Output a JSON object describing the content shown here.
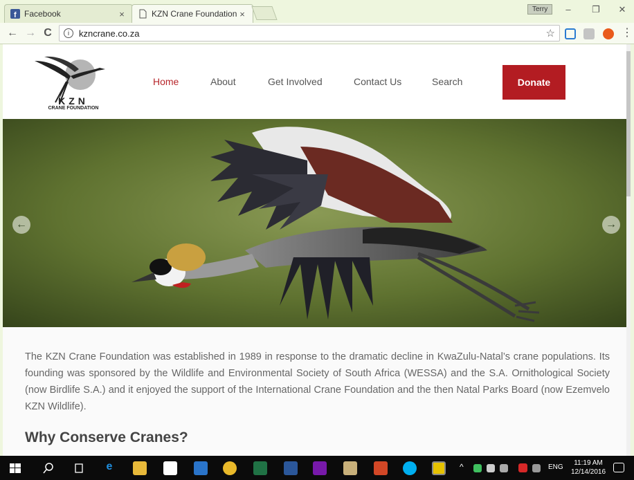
{
  "browser": {
    "tabs": [
      {
        "label": "Facebook",
        "close": "×"
      },
      {
        "label": "KZN Crane Foundation –",
        "close": "×"
      }
    ],
    "user": "Terry",
    "window_controls": {
      "minimize": "–",
      "restore": "❐",
      "close": "✕"
    },
    "nav": {
      "back": "←",
      "forward": "→",
      "reload": "C"
    },
    "url": "kzncrane.co.za",
    "info_glyph": "i",
    "star_glyph": "☆",
    "menu_glyph": "⋮"
  },
  "site": {
    "logo_text": "KZN",
    "logo_sub": "CRANE FOUNDATION",
    "nav": [
      {
        "label": "Home",
        "active": true
      },
      {
        "label": "About"
      },
      {
        "label": "Get Involved"
      },
      {
        "label": "Contact Us"
      },
      {
        "label": "Search"
      }
    ],
    "donate": "Donate",
    "hero": {
      "prev": "←",
      "next": "→"
    },
    "intro": "The KZN Crane Foundation was established in 1989 in response to the dramatic decline in KwaZulu-Natal’s crane populations. Its founding was sponsored by the Wildlife and Environmental Society of South Africa (WESSA) and the S.A. Ornithological Society (now Birdlife S.A.) and it enjoyed the support of the International Crane Foundation and the then Natal Parks Board (now Ezemvelo KZN Wildlife).",
    "heading": "Why Conserve Cranes?"
  },
  "taskbar": {
    "tray_lang": "ENG",
    "time": "11:19 AM",
    "date": "12/14/2016",
    "tray_up": "^"
  },
  "colors": {
    "accent": "#b31c22",
    "taskbar": "#0b0b0b"
  }
}
